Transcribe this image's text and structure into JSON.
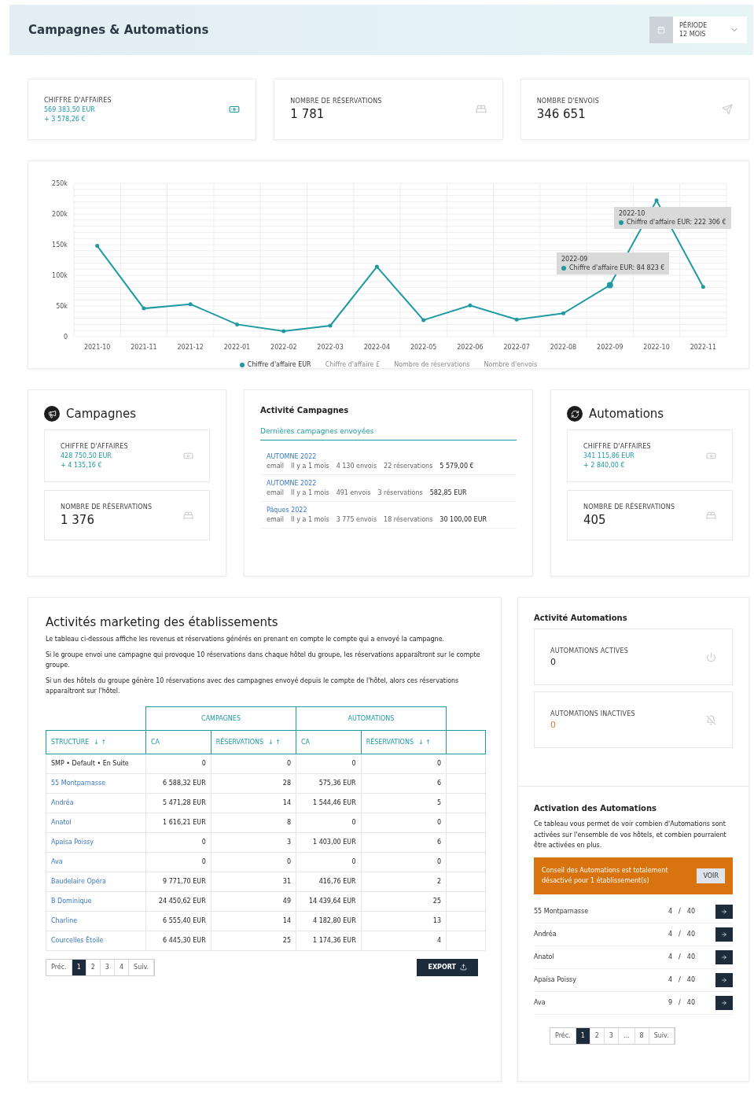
{
  "header": {
    "title": "Campagnes & Automations",
    "period": {
      "label": "PÉRIODE",
      "value": "12 MOIS"
    }
  },
  "kpis": [
    {
      "kind": "money",
      "label": "CHIFFRE D'AFFAIRES",
      "value": "569 383,50 EUR",
      "change": "+ 3 578,26 €"
    },
    {
      "kind": "count",
      "label": "NOMBRE DE RÉSERVATIONS",
      "value": "1 781"
    },
    {
      "kind": "count",
      "label": "NOMBRE D'ENVOIS",
      "value": "346 651"
    }
  ],
  "revenue_chart": {
    "chart_data": {
      "type": "line",
      "grid": true,
      "categories": [
        "2021-10",
        "2021-11",
        "2021-12",
        "2022-01",
        "2022-02",
        "2022-03",
        "2022-04",
        "2022-05",
        "2022-06",
        "2022-07",
        "2022-08",
        "2022-09",
        "2022-10",
        "2022-11"
      ],
      "series": [
        {
          "name": "Chiffre d'affaire EUR",
          "color": "#1f9aa3",
          "values": [
            148000,
            46000,
            53000,
            20000,
            9000,
            18000,
            114000,
            27000,
            51000,
            28000,
            38000,
            84000,
            222000,
            81000
          ]
        }
      ],
      "ylim": [
        0,
        250000
      ],
      "yticks": [
        {
          "value": 0,
          "label": "0"
        },
        {
          "value": 50000,
          "label": "50k"
        },
        {
          "value": 100000,
          "label": "100k"
        },
        {
          "value": 150000,
          "label": "150k"
        },
        {
          "value": 200000,
          "label": "200k"
        },
        {
          "value": 250000,
          "label": "250k"
        }
      ]
    },
    "hidden_series": [
      {
        "label": "Chiffre d'affaire £"
      },
      {
        "label": "Nombre de réservations"
      },
      {
        "label": "Nombre d'envois"
      }
    ],
    "tooltips": [
      {
        "title": "2022-10",
        "text": "Chiffre d'affaire EUR: 222 306 €"
      },
      {
        "title": "2022-09",
        "text": "Chiffre d'affaire EUR: 84 823 €"
      }
    ]
  },
  "campagnes": {
    "title": "Campagnes",
    "revenue": {
      "label": "CHIFFRE D'AFFAIRES",
      "value": "428 750,50 EUR",
      "change": "+ 4 135,16 €"
    },
    "bookings": {
      "label": "NOMBRE DE RÉSERVATIONS",
      "value": "1 376"
    }
  },
  "activite_campagnes": {
    "title": "Activité Campagnes",
    "tab": "Dernières campagnes envoyées",
    "items": [
      {
        "name": "AUTOMNE 2022",
        "channel": "email",
        "when": "Il y a 1 mois",
        "sends": "4 130 envois",
        "bookings": "22 réservations",
        "revenue": "5 579,00 €"
      },
      {
        "name": "AUTOMNE 2022",
        "channel": "email",
        "when": "Il y a 1 mois",
        "sends": "491 envois",
        "bookings": "3 réservations",
        "revenue": "582,85 EUR"
      },
      {
        "name": "Pâques 2022",
        "channel": "email",
        "when": "Il y a 1 mois",
        "sends": "3 775 envois",
        "bookings": "18 réservations",
        "revenue": "30 100,00 EUR"
      }
    ]
  },
  "automations": {
    "title": "Automations",
    "revenue": {
      "label": "CHIFFRE D'AFFAIRES",
      "value": "341 115,86 EUR",
      "change": "+ 2 840,00 €"
    },
    "bookings": {
      "label": "NOMBRE DE RÉSERVATIONS",
      "value": "405"
    }
  },
  "marketing": {
    "title": "Activités marketing des établissements",
    "paragraphs": [
      "Le tableau ci-dessous affiche les revenus et réservations générés en prenant en compte le compte qui a envoyé la campagne.",
      "Si le groupe envoi une campagne qui provoque 10 réservations dans chaque hôtel du groupe, les réservations apparaîtront sur le compte groupe.",
      "Si un des hôtels du groupe génère 10 réservations avec des campagnes envoyé depuis le compte de l'hôtel, alors ces réservations apparaîtront sur l'hôtel."
    ],
    "groups": [
      "CAMPAGNES",
      "AUTOMATIONS"
    ],
    "columns": [
      {
        "label": "STRUCTURE",
        "sort_icons": "↓ ↑"
      },
      {
        "label": "CA"
      },
      {
        "label": "RÉSERVATIONS",
        "sort_icons": "↓ ↑"
      },
      {
        "label": "CA"
      },
      {
        "label": "RÉSERVATIONS",
        "sort_icons": "↓ ↑"
      }
    ],
    "rows": [
      {
        "link": false,
        "cells": [
          "SMP • Default • En Suite",
          "0",
          "0",
          "0",
          "0"
        ]
      },
      {
        "link": true,
        "cells": [
          "55 Montparnasse",
          "6 588,32 EUR",
          "28",
          "575,36 EUR",
          "6"
        ]
      },
      {
        "link": true,
        "cells": [
          "Andréa",
          "5 471,28 EUR",
          "14",
          "1 544,46 EUR",
          "5"
        ]
      },
      {
        "link": true,
        "cells": [
          "Anatol",
          "1 616,21 EUR",
          "8",
          "0",
          "0"
        ]
      },
      {
        "link": true,
        "cells": [
          "Apaisa Poissy",
          "0",
          "3",
          "1 403,00 EUR",
          "6"
        ]
      },
      {
        "link": true,
        "cells": [
          "Ava",
          "0",
          "0",
          "0",
          "0"
        ]
      },
      {
        "link": true,
        "cells": [
          "Baudelaire Opéra",
          "9 771,70 EUR",
          "31",
          "416,76 EUR",
          "2"
        ]
      },
      {
        "link": true,
        "cells": [
          "B Dominique",
          "24 450,62 EUR",
          "49",
          "14 439,64 EUR",
          "25"
        ]
      },
      {
        "link": true,
        "cells": [
          "Charline",
          "6 555,40 EUR",
          "14",
          "4 182,80 EUR",
          "13"
        ]
      },
      {
        "link": true,
        "cells": [
          "Courcelles Étoile",
          "6 445,30 EUR",
          "25",
          "1 174,36 EUR",
          "4"
        ]
      }
    ],
    "pagination": {
      "prev": "Préc.",
      "next": "Suiv.",
      "pages": [
        {
          "label": "1",
          "selected": true
        },
        {
          "label": "2",
          "selected": false
        },
        {
          "label": "3",
          "selected": false
        },
        {
          "label": "4",
          "selected": false
        }
      ]
    },
    "export": "EXPORT"
  },
  "activite_automations": {
    "title": "Activité Automations",
    "stats": [
      {
        "label": "AUTOMATIONS ACTIVES",
        "value": "0",
        "warning": false
      },
      {
        "label": "AUTOMATIONS INACTIVES",
        "value": "0",
        "warning": true
      }
    ]
  },
  "activation": {
    "title": "Activation des Automations",
    "description": "Ce tableau vous permet de voir combien d'Automations sont activées sur l'ensemble de vos hôtels, et combien pourraient être activées en plus.",
    "alert": {
      "text": "Conseil des Automations est totalement désactivé pour 1 établissement(s)",
      "button": "VOIR"
    },
    "rows": [
      {
        "name": "55 Montparnasse",
        "active": "4",
        "sep": "/",
        "total": "40"
      },
      {
        "name": "Andréa",
        "active": "4",
        "sep": "/",
        "total": "40"
      },
      {
        "name": "Anatol",
        "active": "4",
        "sep": "/",
        "total": "40"
      },
      {
        "name": "Apaisa Poissy",
        "active": "4",
        "sep": "/",
        "total": "40"
      },
      {
        "name": "Ava",
        "active": "9",
        "sep": "/",
        "total": "40"
      }
    ],
    "pagination": {
      "prev": "Préc.",
      "next": "Suiv.",
      "pages": [
        {
          "label": "1",
          "selected": true
        },
        {
          "label": "2",
          "selected": false
        },
        {
          "label": "3",
          "selected": false
        },
        {
          "label": "...",
          "selected": false
        },
        {
          "label": "8",
          "selected": false
        }
      ]
    }
  }
}
